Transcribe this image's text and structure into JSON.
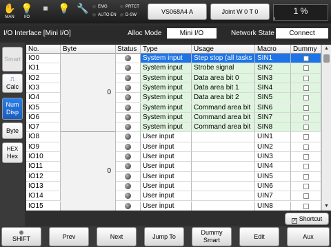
{
  "topbar": {
    "icons": [
      {
        "name": "man-icon",
        "glyph": "✋",
        "label": "MAN"
      },
      {
        "name": "io-bulb-icon",
        "glyph": "💡",
        "label": "I/O"
      },
      {
        "name": "stop-square-icon",
        "glyph": "■",
        "label": ""
      },
      {
        "name": "lamp-icon",
        "glyph": "💡",
        "label": ""
      },
      {
        "name": "wrench-icon",
        "glyph": "🔧",
        "label": ""
      }
    ],
    "leds": {
      "emg": "EMG",
      "auto_en": "AUTO EN",
      "prtct": "PRTCT",
      "d_sw": "D-SW"
    },
    "robot_button": "VS068A4 A",
    "joint_button": "Joint  W 0 T 0",
    "speed_percent": "1 %",
    "speed_fraction": 0.01
  },
  "infobar": {
    "title": "I/O Interface [Mini I/O]",
    "alloc_label": "Alloc Mode",
    "alloc_value": "Mini I/O",
    "network_label": "Network State",
    "network_value": "Connect"
  },
  "left_buttons": {
    "smart": "Smart",
    "calc": "Calc",
    "num": "Num",
    "disp": "Disp",
    "byte": "Byte",
    "hex1": "HEX",
    "hex2": "Hex"
  },
  "table": {
    "headers": {
      "no": "No.",
      "byte": "Byte",
      "status": "Status",
      "type": "Type",
      "usage": "Usage",
      "macro": "Macro",
      "dummy": "Dummy"
    },
    "byte_groups": [
      "0",
      "0"
    ],
    "rows": [
      {
        "no": "IO0",
        "type": "System input",
        "usage": "Step stop (all tasks",
        "macro": "SIN1",
        "kind": "sel"
      },
      {
        "no": "IO1",
        "type": "System input",
        "usage": "Strobe signal",
        "macro": "SIN2",
        "kind": "sys"
      },
      {
        "no": "IO2",
        "type": "System input",
        "usage": "Data area bit 0",
        "macro": "SIN3",
        "kind": "sys"
      },
      {
        "no": "IO3",
        "type": "System input",
        "usage": "Data area bit 1",
        "macro": "SIN4",
        "kind": "sys"
      },
      {
        "no": "IO4",
        "type": "System input",
        "usage": "Data area bit 2",
        "macro": "SIN5",
        "kind": "sys"
      },
      {
        "no": "IO5",
        "type": "System input",
        "usage": "Command area  bit",
        "macro": "SIN6",
        "kind": "sys"
      },
      {
        "no": "IO6",
        "type": "System input",
        "usage": "Command area  bit",
        "macro": "SIN7",
        "kind": "sys"
      },
      {
        "no": "IO7",
        "type": "System input",
        "usage": "Command area  bit",
        "macro": "SIN8",
        "kind": "sys"
      },
      {
        "no": "IO8",
        "type": "User input",
        "usage": "",
        "macro": "UIN1",
        "kind": "user"
      },
      {
        "no": "IO9",
        "type": "User input",
        "usage": "",
        "macro": "UIN2",
        "kind": "user"
      },
      {
        "no": "IO10",
        "type": "User input",
        "usage": "",
        "macro": "UIN3",
        "kind": "user"
      },
      {
        "no": "IO11",
        "type": "User input",
        "usage": "",
        "macro": "UIN4",
        "kind": "user"
      },
      {
        "no": "IO12",
        "type": "User input",
        "usage": "",
        "macro": "UIN5",
        "kind": "user"
      },
      {
        "no": "IO13",
        "type": "User input",
        "usage": "",
        "macro": "UIN6",
        "kind": "user"
      },
      {
        "no": "IO14",
        "type": "User input",
        "usage": "",
        "macro": "UIN7",
        "kind": "user"
      },
      {
        "no": "IO15",
        "type": "User input",
        "usage": "",
        "macro": "UIN8",
        "kind": "user"
      }
    ]
  },
  "shortcut": "Shortcut",
  "fkeys": {
    "shift": "SHIFT",
    "prev": "Prev",
    "next": "Next",
    "jump": "Jump To",
    "dummy1": "Dummy",
    "dummy2": "Smart",
    "edit": "Edit",
    "aux": "Aux"
  }
}
